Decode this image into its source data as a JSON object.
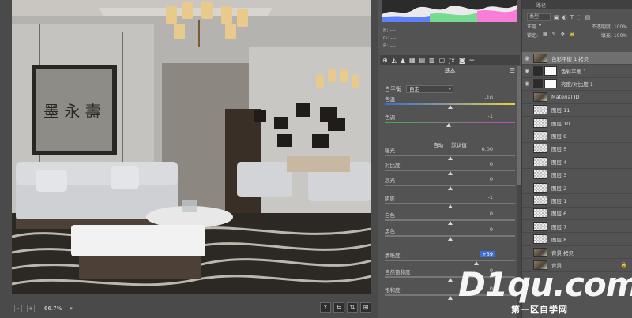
{
  "canvas": {
    "zoom": "66.7%",
    "status_buttons": [
      "-",
      "+"
    ],
    "right_buttons": [
      "Y",
      "⇆",
      "⇅",
      "⊞"
    ]
  },
  "camera_raw": {
    "rgb_readout": [
      "R: ---",
      "G: ---",
      "B: ---"
    ],
    "section_title": "基本",
    "wb_label": "白平衡",
    "wb_value": "自定",
    "auto_label": "自动",
    "default_label": "默认值",
    "sliders": [
      {
        "label": "色温",
        "value": "-10",
        "pos": 0.5
      },
      {
        "label": "色调",
        "value": "-1",
        "pos": 0.49
      },
      {
        "label": "曝光",
        "value": "0.00",
        "pos": 0.5
      },
      {
        "label": "对比度",
        "value": "0",
        "pos": 0.5
      },
      {
        "label": "高光",
        "value": "0",
        "pos": 0.5
      },
      {
        "label": "阴影",
        "value": "-1",
        "pos": 0.5
      },
      {
        "label": "白色",
        "value": "0",
        "pos": 0.5
      },
      {
        "label": "黑色",
        "value": "0",
        "pos": 0.5
      },
      {
        "label": "清晰度",
        "value": "+39",
        "pos": 0.7,
        "highlight": true
      },
      {
        "label": "自然饱和度",
        "value": "0",
        "pos": 0.5
      },
      {
        "label": "饱和度",
        "value": "0",
        "pos": 0.5
      }
    ]
  },
  "layers": {
    "tabs": [
      "",
      "路径"
    ],
    "filter_label": "类型",
    "blend_mode": "正常",
    "opacity_label": "不透明度:",
    "opacity_value": "100%",
    "lock_label": "锁定:",
    "fill_label": "填充:",
    "fill_value": "100%",
    "items": [
      {
        "name": "色彩平衡 1 拷贝",
        "thumb": "photo",
        "selected": true,
        "eye": true
      },
      {
        "name": "色彩平衡 1",
        "thumb": "adj",
        "eye": true
      },
      {
        "name": "亮度/对比度 1",
        "thumb": "adj",
        "eye": true
      },
      {
        "name": "Material ID",
        "thumb": "photo",
        "eye": false
      },
      {
        "name": "图层 11",
        "thumb": "checker",
        "eye": false
      },
      {
        "name": "图层 10",
        "thumb": "checker",
        "eye": false
      },
      {
        "name": "图层 9",
        "thumb": "checker",
        "eye": false
      },
      {
        "name": "图层 5",
        "thumb": "checker",
        "eye": false
      },
      {
        "name": "图层 4",
        "thumb": "checker",
        "eye": false
      },
      {
        "name": "图层 3",
        "thumb": "checker",
        "eye": false
      },
      {
        "name": "图层 2",
        "thumb": "checker",
        "eye": false
      },
      {
        "name": "图层 1",
        "thumb": "checker",
        "eye": false
      },
      {
        "name": "图层 6",
        "thumb": "checker",
        "eye": false
      },
      {
        "name": "图层 7",
        "thumb": "checker",
        "eye": false
      },
      {
        "name": "图层 8",
        "thumb": "checker",
        "eye": false
      },
      {
        "name": "背景 拷贝",
        "thumb": "photo",
        "eye": false
      },
      {
        "name": "背景",
        "thumb": "photo",
        "eye": false,
        "locked": true
      }
    ]
  },
  "watermark": {
    "logo": "D1qu.com",
    "sub": "第一区自学网"
  }
}
